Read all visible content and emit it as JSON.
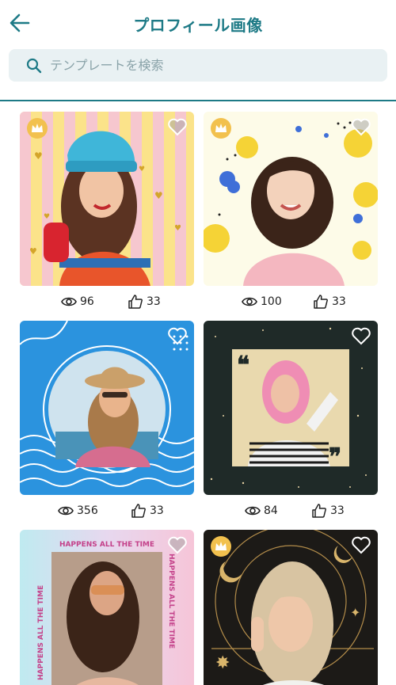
{
  "header": {
    "title": "プロフィール画像"
  },
  "search": {
    "placeholder": "テンプレートを検索"
  },
  "colors": {
    "accent": "#1d7a86",
    "search_bg": "#e9f1f3",
    "crown": "#f2c14e"
  },
  "cards": [
    {
      "views": "96",
      "likes": "33",
      "premium": true,
      "liked": false
    },
    {
      "views": "100",
      "likes": "33",
      "premium": true,
      "liked": false
    },
    {
      "views": "356",
      "likes": "33",
      "premium": false,
      "liked": false
    },
    {
      "views": "84",
      "likes": "33",
      "premium": false,
      "liked": false
    },
    {
      "premium": false,
      "liked": false,
      "overlay_text": "HAPPENS ALL THE TIME"
    },
    {
      "premium": true,
      "liked": false
    }
  ]
}
